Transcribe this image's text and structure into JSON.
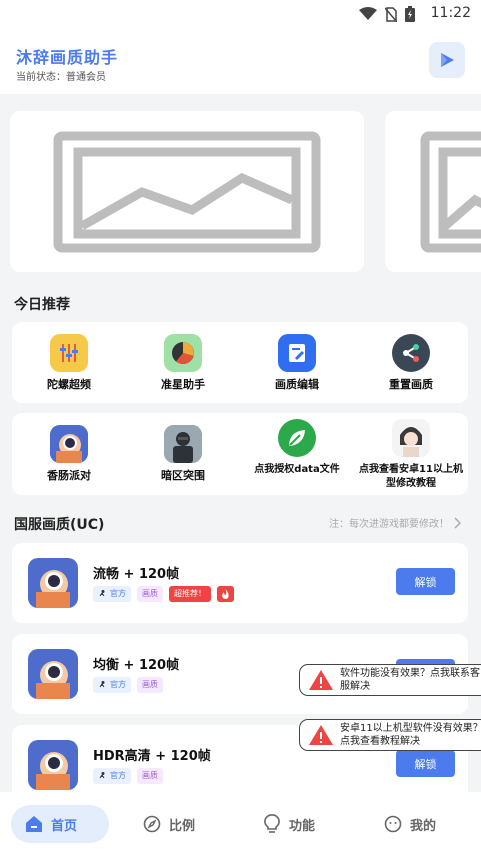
{
  "status_bar": {
    "time": "11:22"
  },
  "header": {
    "title": "沐辞画质助手",
    "status": "当前状态：普通会员"
  },
  "sections": {
    "today": "今日推荐",
    "cn_server": "国服画质(UC)",
    "cn_note": "注：每次进游戏都要修改！"
  },
  "recommend_row1": [
    {
      "label": "陀螺超频",
      "icon": "sliders-icon"
    },
    {
      "label": "准星助手",
      "icon": "pie-icon"
    },
    {
      "label": "画质编辑",
      "icon": "edit-doc-icon"
    },
    {
      "label": "重置画质",
      "icon": "share-icon"
    }
  ],
  "recommend_row2": [
    {
      "label": "香肠派对",
      "icon": "sausage-game-icon"
    },
    {
      "label": "暗区突围",
      "icon": "soldier-game-icon"
    },
    {
      "label": "点我授权data文件",
      "icon": "leaf-icon"
    },
    {
      "label": "点我查看安卓11以上机型修改教程",
      "icon": "anime-avatar-icon"
    }
  ],
  "games": [
    {
      "name": "流畅 + 120帧",
      "tags": [
        "官方",
        "画质",
        "超推荐！"
      ],
      "button": "解锁"
    },
    {
      "name": "均衡 + 120帧",
      "tags": [
        "官方",
        "画质"
      ],
      "button": "解锁"
    },
    {
      "name": "HDR高清 + 120帧",
      "tags": [
        "官方",
        "画质"
      ],
      "button": "解锁"
    }
  ],
  "toasts": [
    "软件功能没有效果？点我联系客服解决",
    "安卓11以上机型软件没有效果？点我查看教程解决"
  ],
  "tabs": [
    {
      "label": "首页",
      "icon": "home-icon"
    },
    {
      "label": "比例",
      "icon": "compass-icon"
    },
    {
      "label": "功能",
      "icon": "bulb-icon"
    },
    {
      "label": "我的",
      "icon": "face-icon"
    }
  ],
  "colors": {
    "accent": "#4b7bec",
    "danger": "#ef4444"
  }
}
